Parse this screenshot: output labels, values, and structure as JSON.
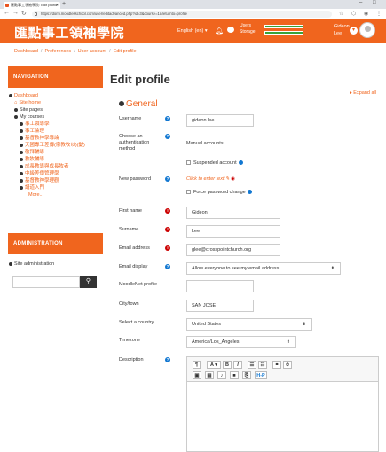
{
  "browser": {
    "tab_title": "匯點事工領袖學院: Edit profile",
    "tab_close": "×",
    "new_tab": "+",
    "minimize": "–",
    "maximize": "□",
    "url": "https://domi.moodlesschool.com/user/editadvanced.php?id=3&course=1&returnto=profile",
    "back": "←",
    "forward": "→",
    "reload": "↻"
  },
  "header": {
    "brand": "匯點事工領袖學院",
    "language": "English (en) ▾",
    "quota_users_label": "Users",
    "quota_storage_label": "Storage",
    "user_name_line1": "Gideon",
    "user_name_line2": "Lee",
    "user_menu_chevron": "▾",
    "color": "#f0651e"
  },
  "breadcrumb": [
    "Dashboard",
    "Preferences",
    "User account",
    "Edit profile"
  ],
  "sidebar": {
    "navigation_title": "NAVIGATION",
    "nav_items": {
      "dashboard": "Dashboard",
      "site_home": "Site home",
      "site_pages": "Site pages",
      "my_courses": "My courses",
      "more": "More..."
    },
    "courses": [
      "事工領導學",
      "事工倫理",
      "基督教神學導論",
      "天國專工差傳(宗教牧以)(動)",
      "敬拜輔導",
      "教牧輔導",
      "成長教導與成長牧者",
      "中級差傳管理學",
      "基督教神學理觀",
      "講道入門"
    ],
    "administration_title": "ADMINISTRATION",
    "site_administration": "Site administration",
    "search_icon": "🔍"
  },
  "main": {
    "title": "Edit profile",
    "expand_all": "Expand all",
    "section_general": "General",
    "fields": {
      "username_label": "Username",
      "username_value": "gideon.lee",
      "auth_label_1": "Choose an",
      "auth_label_2": "authentication",
      "auth_label_3": "method",
      "auth_value": "Manual accounts",
      "suspended_label": "Suspended account",
      "new_password_label": "New password",
      "new_password_link": "Click to enter text ✎",
      "force_change_label": "Force password change",
      "firstname_label": "First name",
      "firstname_value": "Gideon",
      "surname_label": "Surname",
      "surname_value": "Lee",
      "email_label": "Email address",
      "email_value": "glee@crosspointchurch.org",
      "email_display_label": "Email display",
      "email_display_value": "Allow everyone to see my email address",
      "moodlenet_label": "MoodleNet profile",
      "moodlenet_value": "",
      "city_label": "City/town",
      "city_value": "SAN JOSE",
      "country_label": "Select a country",
      "country_value": "United States",
      "timezone_label": "Timezone",
      "timezone_value": "America/Los_Angeles",
      "description_label": "Description"
    },
    "help_icon_glyph": "?",
    "required_icon_glyph": "!",
    "select_caret": "⬍",
    "editor_tools": [
      "¶",
      "A ▾",
      "B",
      "I",
      "☰",
      "☷",
      "⚭",
      "⦸",
      "▣",
      "▤",
      "♪",
      "■",
      "⎘",
      "H-P"
    ]
  }
}
